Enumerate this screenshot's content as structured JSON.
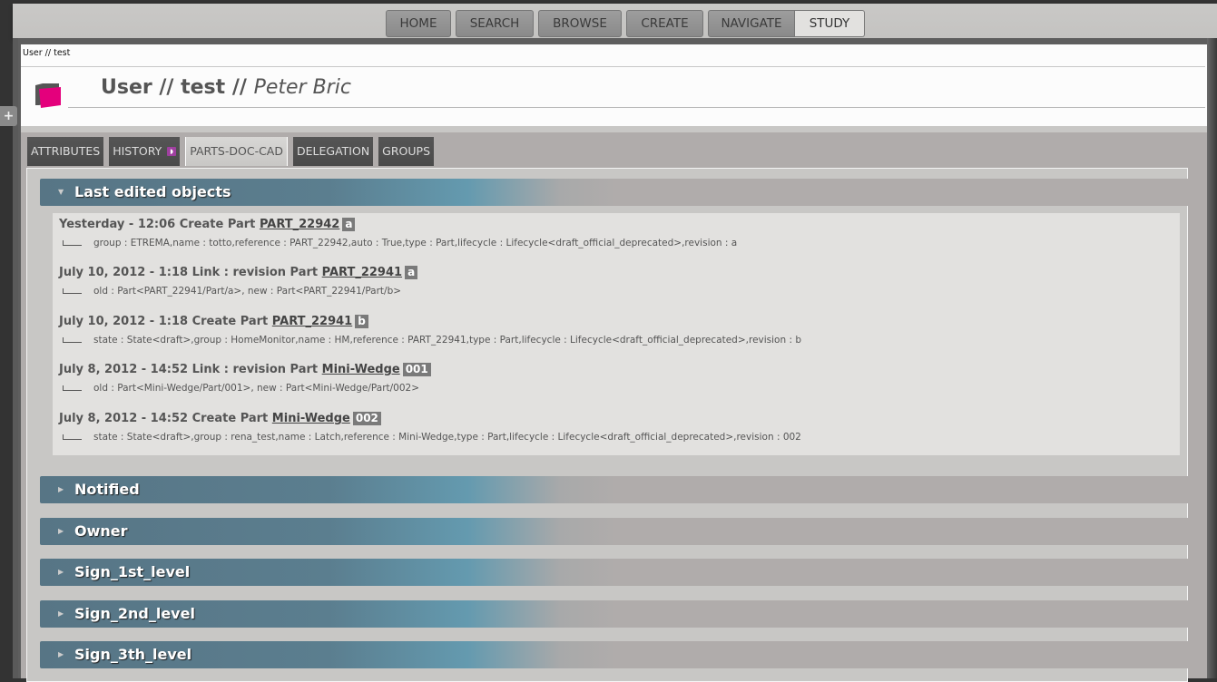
{
  "topnav": {
    "items": [
      {
        "label": "HOME"
      },
      {
        "label": "SEARCH"
      },
      {
        "label": "BROWSE"
      },
      {
        "label": "CREATE"
      },
      {
        "label": "NAVIGATE"
      },
      {
        "label": "STUDY"
      }
    ],
    "active": "STUDY"
  },
  "sidebar_toggle": "+",
  "header": {
    "breadcrumb": "User // test",
    "title_prefix": "User // test // ",
    "title_name": "Peter Bric",
    "logo_colors": {
      "back": "#555555",
      "front": "#e4007c"
    }
  },
  "tabs": [
    {
      "label": "ATTRIBUTES"
    },
    {
      "label": "HISTORY",
      "icon": "rss-icon"
    },
    {
      "label": "PARTS-DOC-CAD"
    },
    {
      "label": "DELEGATION"
    },
    {
      "label": "GROUPS"
    }
  ],
  "active_tab": "PARTS-DOC-CAD",
  "sections": {
    "last_edited": {
      "label": "Last edited objects",
      "expanded": true,
      "entries": [
        {
          "prefix": "Yesterday - 12:06 Create Part ",
          "link": "PART_22942",
          "badge": "a",
          "detail": "group : ETREMA,name : totto,reference : PART_22942,auto : True,type : Part,lifecycle : Lifecycle<draft_official_deprecated>,revision : a"
        },
        {
          "prefix": "July 10, 2012 - 1:18 Link : revision Part ",
          "link": "PART_22941",
          "badge": "a",
          "detail": "old : Part<PART_22941/Part/a>, new : Part<PART_22941/Part/b>"
        },
        {
          "prefix": "July 10, 2012 - 1:18 Create Part ",
          "link": "PART_22941",
          "badge": "b",
          "detail": "state : State<draft>,group : HomeMonitor,name : HM,reference : PART_22941,type : Part,lifecycle : Lifecycle<draft_official_deprecated>,revision : b"
        },
        {
          "prefix": "July 8, 2012 - 14:52 Link : revision Part ",
          "link": "Mini-Wedge",
          "badge": "001",
          "detail": "old : Part<Mini-Wedge/Part/001>, new : Part<Mini-Wedge/Part/002>"
        },
        {
          "prefix": "July 8, 2012 - 14:52 Create Part ",
          "link": "Mini-Wedge",
          "badge": "002",
          "detail": "state : State<draft>,group : rena_test,name : Latch,reference : Mini-Wedge,type : Part,lifecycle : Lifecycle<draft_official_deprecated>,revision : 002"
        }
      ]
    },
    "collapsed": [
      {
        "label": "Notified"
      },
      {
        "label": "Owner"
      },
      {
        "label": "Sign_1st_level"
      },
      {
        "label": "Sign_2nd_level"
      },
      {
        "label": "Sign_3th_level"
      }
    ]
  },
  "icons": {
    "expanded_arrow": "▼",
    "collapsed_arrow": "▶"
  }
}
